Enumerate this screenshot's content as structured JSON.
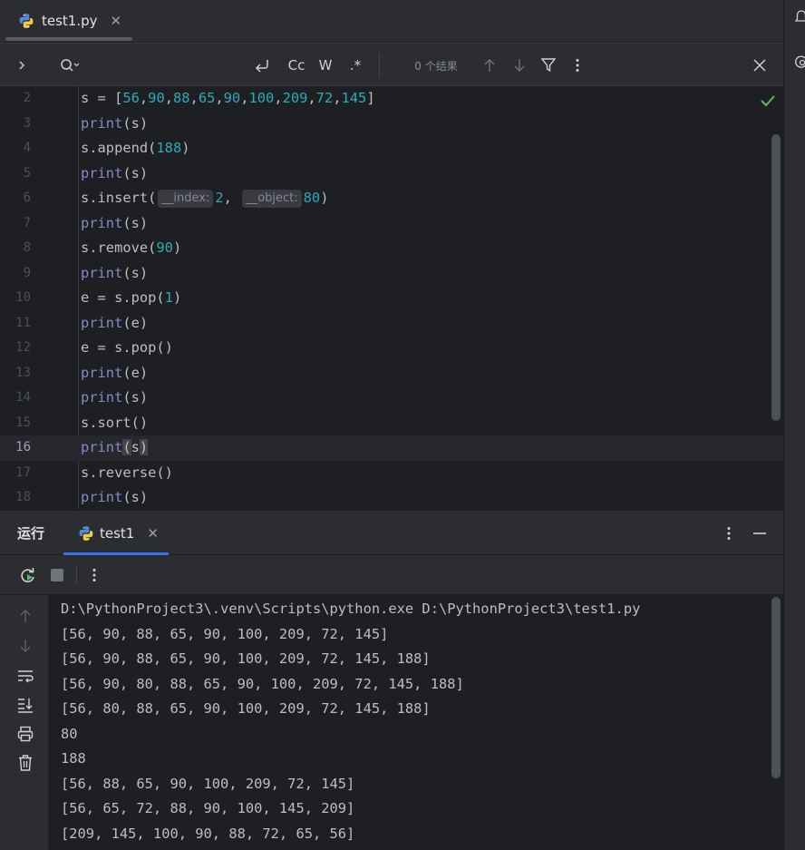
{
  "tab": {
    "filename": "test1.py"
  },
  "find": {
    "case_label": "Cc",
    "words_label": "W",
    "regex_label": ".*",
    "results": "0 个结果"
  },
  "editor": {
    "current_line": "16",
    "lines": [
      {
        "no": "2"
      },
      {
        "no": "3"
      },
      {
        "no": "4"
      },
      {
        "no": "5"
      },
      {
        "no": "6"
      },
      {
        "no": "7"
      },
      {
        "no": "8"
      },
      {
        "no": "9"
      },
      {
        "no": "10"
      },
      {
        "no": "11"
      },
      {
        "no": "12"
      },
      {
        "no": "13"
      },
      {
        "no": "14"
      },
      {
        "no": "15"
      },
      {
        "no": "16"
      },
      {
        "no": "17"
      },
      {
        "no": "18"
      }
    ],
    "code": {
      "l2_prefix": "s = [",
      "l2_nums": [
        "56",
        "90",
        "88",
        "65",
        "90",
        "100",
        "209",
        "72",
        "145"
      ],
      "l2_suffix": "]",
      "print": "print",
      "arg_s": "(s)",
      "arg_e": "(e)",
      "append": "s.append(",
      "append_num": "188",
      "insert": "s.insert(",
      "hint_index": "__index:",
      "insert_num1": "2",
      "hint_object": "__object:",
      "insert_num2": "80",
      "remove": "s.remove(",
      "remove_num": "90",
      "pop1_prefix": "e = s.pop(",
      "pop1_num": "1",
      "pop2": "e = s.pop()",
      "sort": "s.sort()",
      "reverse": "s.reverse()",
      "close_paren": ")",
      "comma": ",",
      "l16_open": "(",
      "l16_s": "s",
      "l16_close": ")"
    },
    "status": "check-icon"
  },
  "run": {
    "title": "运行",
    "tab_label": "test1",
    "accent": "#3574f0"
  },
  "console": {
    "lines": [
      "D:\\PythonProject3\\.venv\\Scripts\\python.exe D:\\PythonProject3\\test1.py",
      "[56, 90, 88, 65, 90, 100, 209, 72, 145]",
      "[56, 90, 88, 65, 90, 100, 209, 72, 145, 188]",
      "[56, 90, 80, 88, 65, 90, 100, 209, 72, 145, 188]",
      "[56, 80, 88, 65, 90, 100, 209, 72, 145, 188]",
      "80",
      "188",
      "[56, 88, 65, 90, 100, 209, 72, 145]",
      "[56, 65, 72, 88, 90, 100, 145, 209]",
      "[209, 145, 100, 90, 88, 72, 65, 56]"
    ]
  },
  "colors": {
    "builtin": "#8888c6",
    "number": "#2aacb8",
    "text": "#bcbec4",
    "background": "#1e1f22",
    "panel": "#2b2d30"
  }
}
